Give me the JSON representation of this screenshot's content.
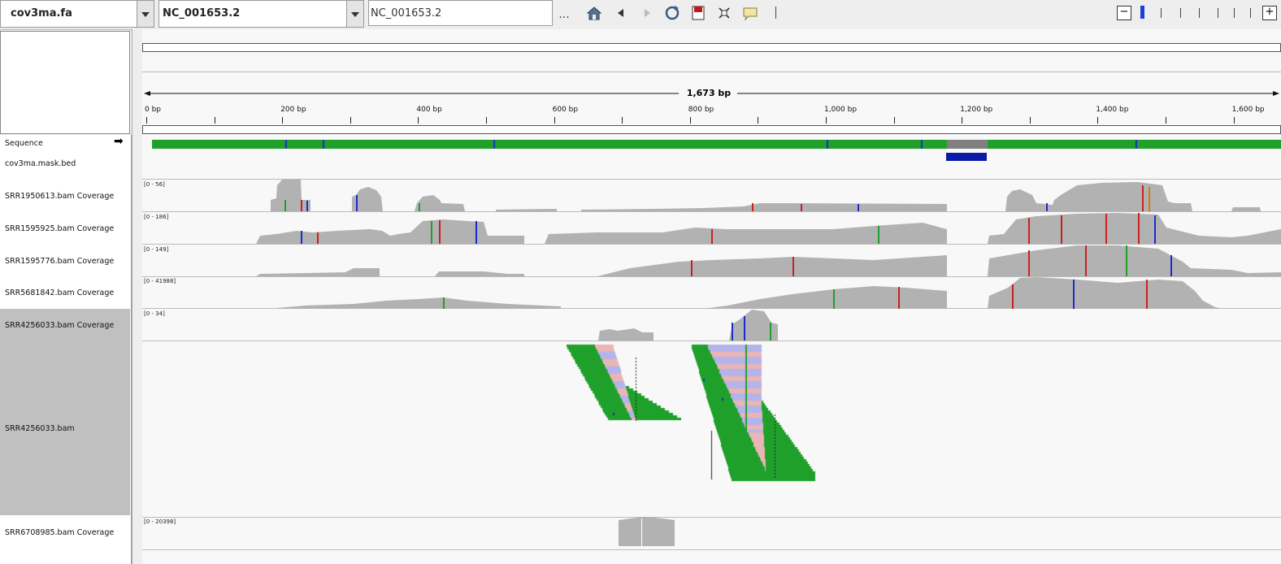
{
  "toolbar": {
    "genome": "cov3ma.fa",
    "chromosome": "NC_001653.2",
    "locus": "NC_001653.2",
    "more": "...",
    "zoom_minus": "−",
    "zoom_plus": "+"
  },
  "ruler": {
    "span": "1,673 bp",
    "ticks": [
      "0 bp",
      "200 bp",
      "400 bp",
      "600 bp",
      "800 bp",
      "1,000 bp",
      "1,200 bp",
      "1,400 bp",
      "1,600 bp"
    ]
  },
  "tracks": [
    {
      "name": "Sequence",
      "arrow": "➡"
    },
    {
      "name": "cov3ma.mask.bed"
    },
    {
      "name": "SRR1950613.bam Coverage",
      "range": "[0 - 56]"
    },
    {
      "name": "SRR1595925.bam Coverage",
      "range": "[0 - 186]"
    },
    {
      "name": "SRR1595776.bam Coverage",
      "range": "[0 - 149]"
    },
    {
      "name": "SRR5681842.bam Coverage",
      "range": "[0 - 41988]"
    },
    {
      "name": "SRR4256033.bam Coverage",
      "range": "[0 - 34]"
    },
    {
      "name": "SRR4256033.bam"
    },
    {
      "name": "SRR6708985.bam Coverage",
      "range": "[0 - 20398]"
    }
  ],
  "colors": {
    "coverage": "#b2b2b2",
    "mask_feature": "#0a1aa8",
    "selected_track": "#c0c0c0"
  }
}
